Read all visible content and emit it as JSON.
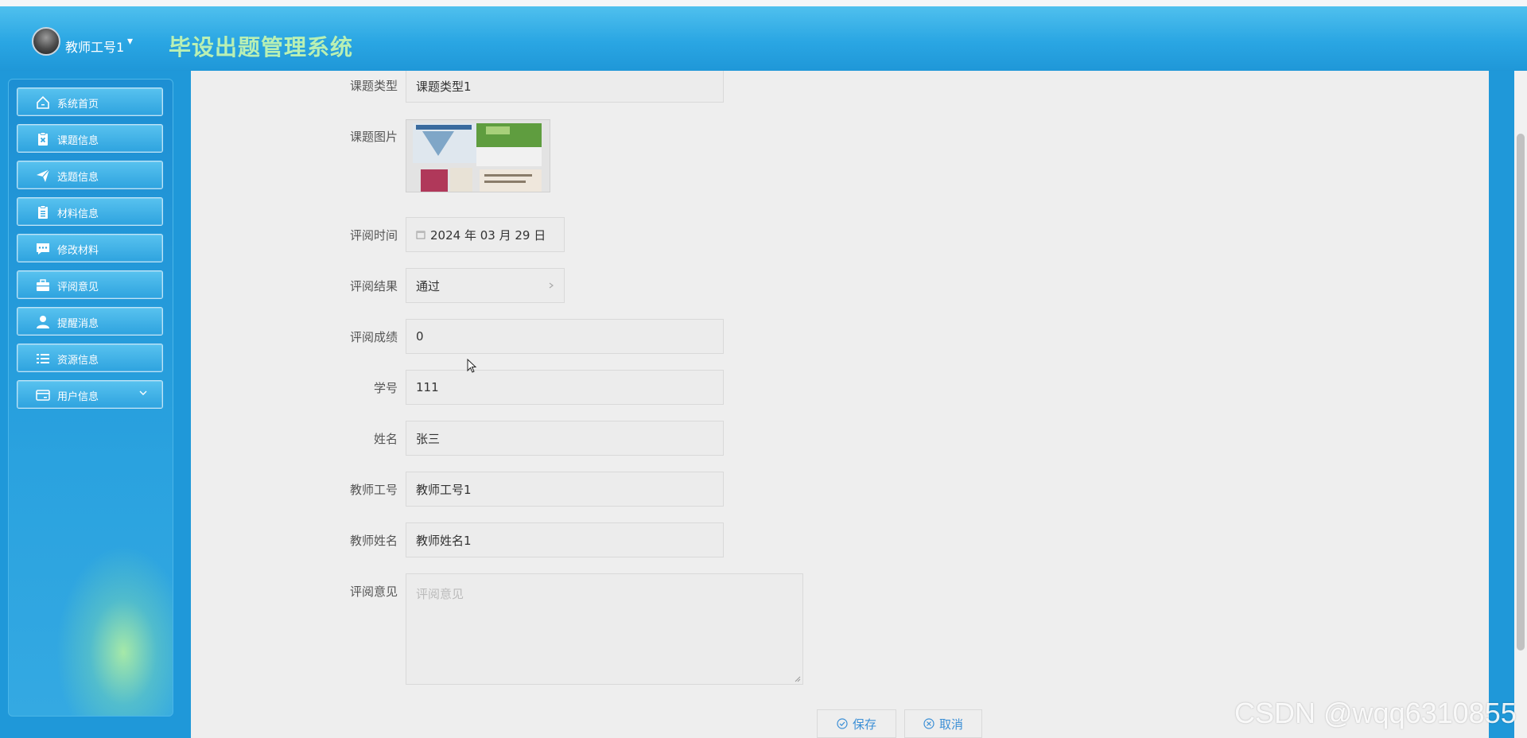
{
  "header": {
    "user_name": "教师工号1",
    "caret": "▾",
    "app_title": "毕设出题管理系统"
  },
  "sidebar": {
    "items": [
      {
        "label": "系统首页",
        "icon": "home-icon"
      },
      {
        "label": "课题信息",
        "icon": "clipboard-x-icon"
      },
      {
        "label": "选题信息",
        "icon": "send-icon"
      },
      {
        "label": "材料信息",
        "icon": "clipboard-icon"
      },
      {
        "label": "修改材料",
        "icon": "chat-icon"
      },
      {
        "label": "评阅意见",
        "icon": "briefcase-icon"
      },
      {
        "label": "提醒消息",
        "icon": "user-icon"
      },
      {
        "label": "资源信息",
        "icon": "list-icon"
      },
      {
        "label": "用户信息",
        "icon": "card-icon",
        "expandable": true
      }
    ]
  },
  "form": {
    "topic_type": {
      "label": "课题类型",
      "value": "课题类型1"
    },
    "topic_image": {
      "label": "课题图片"
    },
    "review_time": {
      "label": "评阅时间",
      "value": "2024 年 03 月 29 日"
    },
    "review_result": {
      "label": "评阅结果",
      "value": "通过"
    },
    "review_score": {
      "label": "评阅成绩",
      "value": "0"
    },
    "student_id": {
      "label": "学号",
      "value": "111"
    },
    "name": {
      "label": "姓名",
      "value": "张三"
    },
    "teacher_id": {
      "label": "教师工号",
      "value": "教师工号1"
    },
    "teacher_name": {
      "label": "教师姓名",
      "value": "教师姓名1"
    },
    "review_comment": {
      "label": "评阅意见",
      "placeholder": "评阅意见"
    }
  },
  "buttons": {
    "save": "保存",
    "cancel": "取消"
  },
  "watermark": "CSDN @wqq6310855",
  "colors": {
    "header_blue": "#2aa6e3",
    "title_green": "#b9f0b4",
    "content_bg": "#eeeeee",
    "button_text": "#3b8fd6"
  }
}
